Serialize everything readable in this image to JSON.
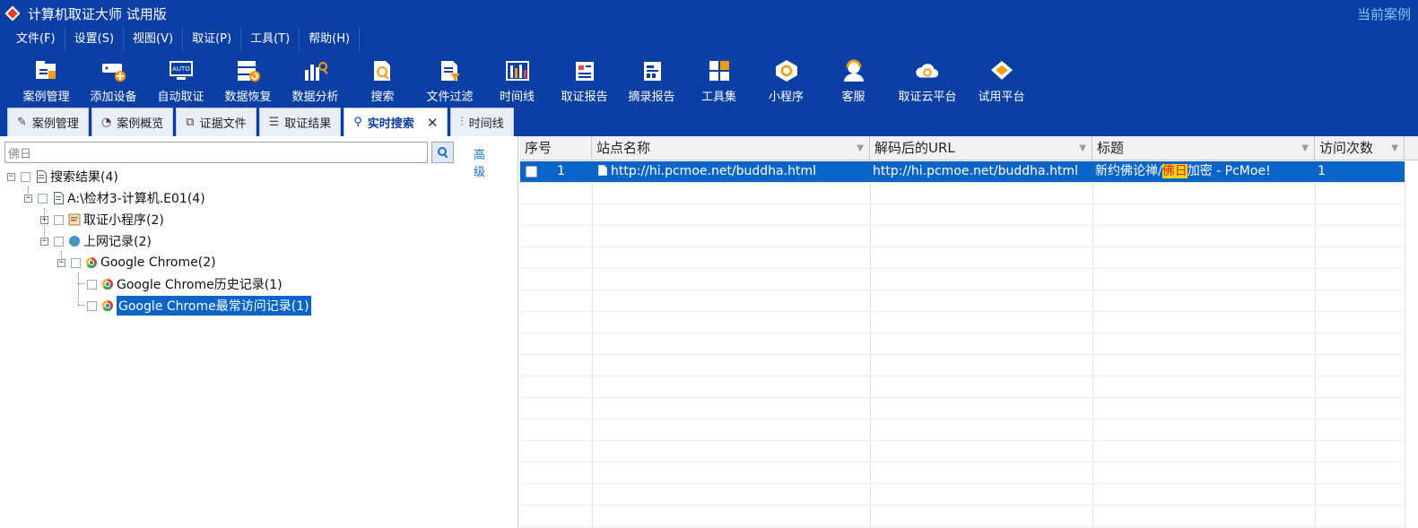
{
  "app": {
    "title": "计算机取证大师 试用版",
    "current_case": "当前案例"
  },
  "menu": [
    "文件(F)",
    "设置(S)",
    "视图(V)",
    "取证(P)",
    "工具(T)",
    "帮助(H)"
  ],
  "toolbar": [
    {
      "label": "案例管理",
      "icon": "case-icon"
    },
    {
      "label": "添加设备",
      "icon": "add-device-icon"
    },
    {
      "label": "自动取证",
      "icon": "auto-icon"
    },
    {
      "label": "数据恢复",
      "icon": "recover-icon"
    },
    {
      "label": "数据分析",
      "icon": "analysis-icon"
    },
    {
      "label": "搜索",
      "icon": "search-doc-icon"
    },
    {
      "label": "文件过滤",
      "icon": "filter-icon"
    },
    {
      "label": "时间线",
      "icon": "timeline-icon"
    },
    {
      "label": "取证报告",
      "icon": "report-icon"
    },
    {
      "label": "摘录报告",
      "icon": "excerpt-icon"
    },
    {
      "label": "工具集",
      "icon": "tools-icon"
    },
    {
      "label": "小程序",
      "icon": "miniapp-icon"
    },
    {
      "label": "客服",
      "icon": "support-icon"
    },
    {
      "label": "取证云平台",
      "icon": "cloud-icon"
    },
    {
      "label": "试用平台",
      "icon": "trial-icon"
    }
  ],
  "tabs": [
    {
      "label": "案例管理",
      "active": false
    },
    {
      "label": "案例概览",
      "active": false
    },
    {
      "label": "证据文件",
      "active": false
    },
    {
      "label": "取证结果",
      "active": false
    },
    {
      "label": "实时搜索",
      "active": true
    },
    {
      "label": "时间线",
      "active": false
    }
  ],
  "search": {
    "value": "佛日",
    "advanced": "高级"
  },
  "tree": {
    "root": "搜索结果(4)",
    "evidence": "A:\\检材3-计算机.E01(4)",
    "miniapp": "取证小程序(2)",
    "web": "上网记录(2)",
    "chrome": "Google Chrome(2)",
    "history": "Google Chrome历史记录(1)",
    "topsites": "Google Chrome最常访问记录(1)"
  },
  "grid": {
    "columns": [
      "序号",
      "站点名称",
      "解码后的URL",
      "标题",
      "访问次数"
    ],
    "rows": [
      {
        "index": "1",
        "site": "http://hi.pcmoe.net/buddha.html",
        "url": "http://hi.pcmoe.net/buddha.html",
        "title_pre": "新约佛论禅/",
        "title_hl": "佛日",
        "title_post": "加密 - PcMoe!",
        "visits": "1"
      }
    ]
  }
}
